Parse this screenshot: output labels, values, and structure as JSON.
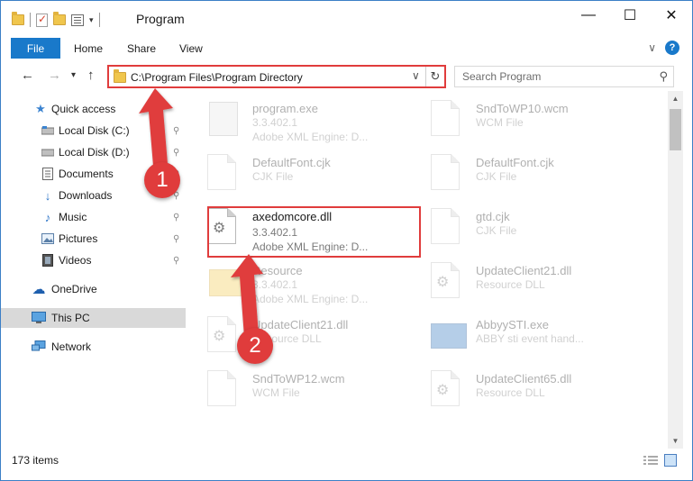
{
  "window": {
    "title": "Program",
    "controls": {
      "minimize": "—",
      "maximize": "☐",
      "close": "✕"
    }
  },
  "ribbon": {
    "file_tab": "File",
    "tabs": [
      "Home",
      "Share",
      "View"
    ],
    "expand": "∨",
    "help": "?"
  },
  "nav": {
    "back": "←",
    "forward": "→",
    "recent": "▾",
    "up": "↑",
    "address": "C:\\Program Files\\Program Directory",
    "address_dropdown": "∨",
    "refresh": "↻",
    "search_placeholder": "Search Program",
    "search_icon": "⚲"
  },
  "sidebar": {
    "items": [
      {
        "label": "Quick access",
        "icon": "★"
      },
      {
        "label": "Local Disk (C:)",
        "icon": "drive"
      },
      {
        "label": "Local Disk (D:)",
        "icon": "drive"
      },
      {
        "label": "Documents",
        "icon": "doc"
      },
      {
        "label": "Downloads",
        "icon": "↓"
      },
      {
        "label": "Music",
        "icon": "♪"
      },
      {
        "label": "Pictures",
        "icon": "pic"
      },
      {
        "label": "Videos",
        "icon": "vid"
      },
      {
        "label": "OneDrive",
        "icon": "☁"
      },
      {
        "label": "This PC",
        "icon": "pc"
      },
      {
        "label": "Network",
        "icon": "net"
      }
    ],
    "pin": "📌"
  },
  "files": [
    {
      "name": "program.exe",
      "line1": "3.3.402.1",
      "line2": "Adobe XML Engine: D...",
      "icon": "exe"
    },
    {
      "name": "SndToWP10.wcm",
      "line1": "WCM File",
      "line2": "",
      "icon": "doc"
    },
    {
      "name": "DefaultFont.cjk",
      "line1": "CJK File",
      "line2": "",
      "icon": "doc"
    },
    {
      "name": "DefaultFont.cjk",
      "line1": "CJK File",
      "line2": "",
      "icon": "doc"
    },
    {
      "name": "axedomcore.dll",
      "line1": "3.3.402.1",
      "line2": "Adobe XML Engine: D...",
      "icon": "dll"
    },
    {
      "name": "gtd.cjk",
      "line1": "CJK File",
      "line2": "",
      "icon": "doc"
    },
    {
      "name": "Resource",
      "line1": "3.3.402.1",
      "line2": "Adobe XML Engine: D...",
      "icon": "folder"
    },
    {
      "name": "UpdateClient21.dll",
      "line1": "Resource DLL",
      "line2": "",
      "icon": "dll"
    },
    {
      "name": "UpdateClient21.dll",
      "line1": "Resource DLL",
      "line2": "",
      "icon": "dll"
    },
    {
      "name": "AbbyySTI.exe",
      "line1": "ABBY sti event hand...",
      "line2": "",
      "icon": "blueexe"
    },
    {
      "name": "SndToWP12.wcm",
      "line1": "WCM File",
      "line2": "",
      "icon": "doc"
    },
    {
      "name": "UpdateClient65.dll",
      "line1": "Resource DLL",
      "line2": "",
      "icon": "dll"
    }
  ],
  "status": {
    "item_count": "173 items"
  },
  "annotations": {
    "step1": "1",
    "step2": "2",
    "arrow_color": "#e03c3c"
  }
}
